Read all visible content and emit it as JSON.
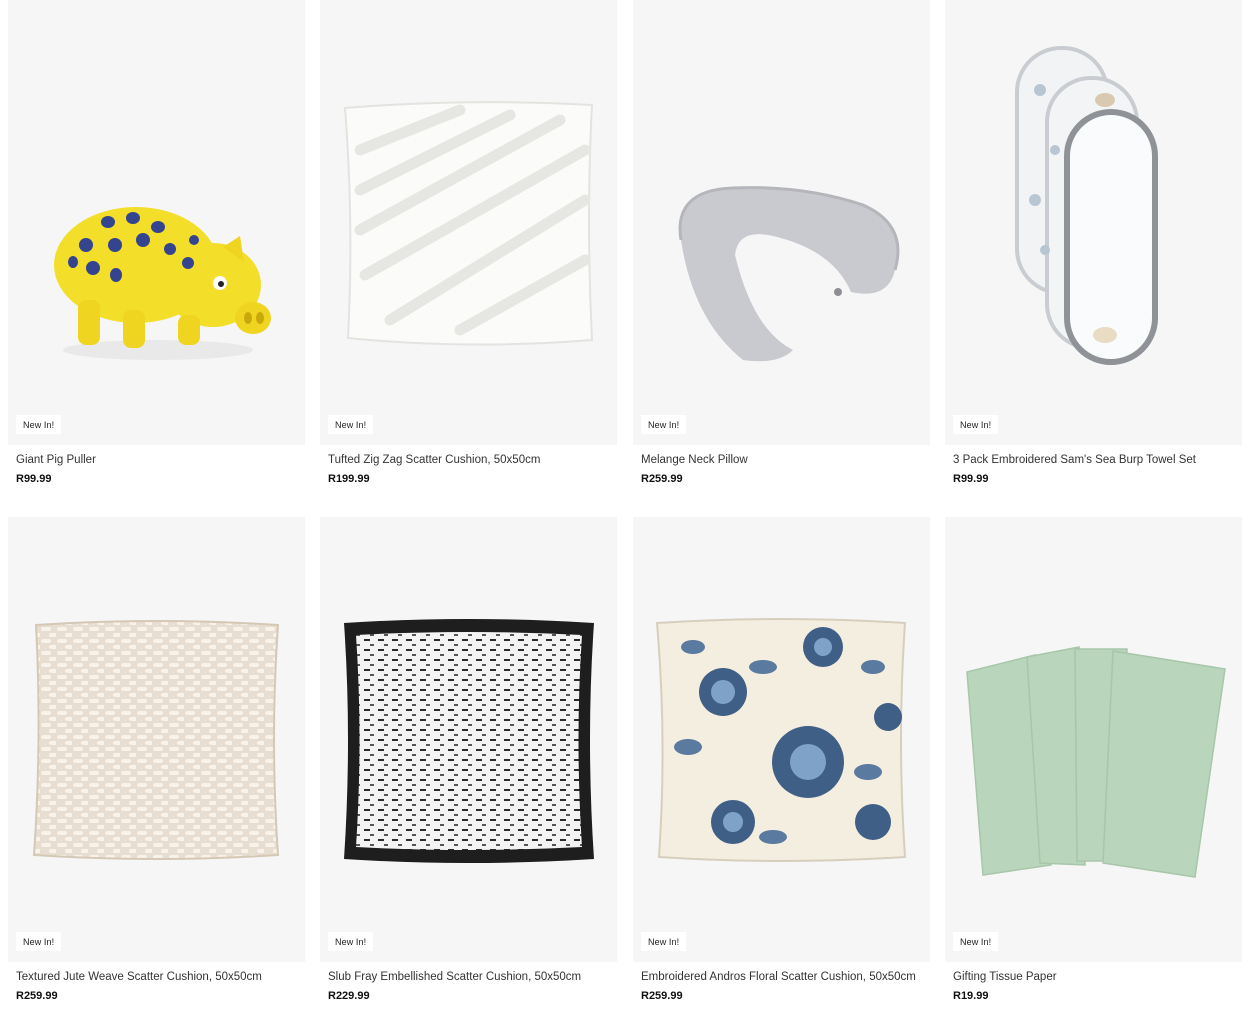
{
  "products": [
    {
      "name": "Giant Pig Puller",
      "price": "R99.99",
      "badge": "New In!",
      "image_icon": "yellow-pig-toy-icon"
    },
    {
      "name": "Tufted Zig Zag Scatter Cushion, 50x50cm",
      "price": "R199.99",
      "badge": "New In!",
      "image_icon": "white-tufted-cushion-icon"
    },
    {
      "name": "Melange Neck Pillow",
      "price": "R259.99",
      "badge": "New In!",
      "image_icon": "grey-neck-pillow-icon"
    },
    {
      "name": "3 Pack Embroidered Sam's Sea Burp Towel Set",
      "price": "R99.99",
      "badge": "New In!",
      "image_icon": "burp-towel-set-icon"
    },
    {
      "name": "Textured Jute Weave Scatter Cushion, 50x50cm",
      "price": "R259.99",
      "badge": "New In!",
      "image_icon": "jute-weave-cushion-icon"
    },
    {
      "name": "Slub Fray Embellished Scatter Cushion, 50x50cm",
      "price": "R229.99",
      "badge": "New In!",
      "image_icon": "fray-cushion-icon"
    },
    {
      "name": "Embroidered Andros Floral Scatter Cushion, 50x50cm",
      "price": "R259.99",
      "badge": "New In!",
      "image_icon": "floral-cushion-icon"
    },
    {
      "name": "Gifting Tissue Paper",
      "price": "R19.99",
      "badge": "New In!",
      "image_icon": "tissue-paper-icon"
    }
  ],
  "colors": {
    "card_background": "#f6f6f6",
    "badge_background": "#ffffff",
    "text": "#222222"
  }
}
